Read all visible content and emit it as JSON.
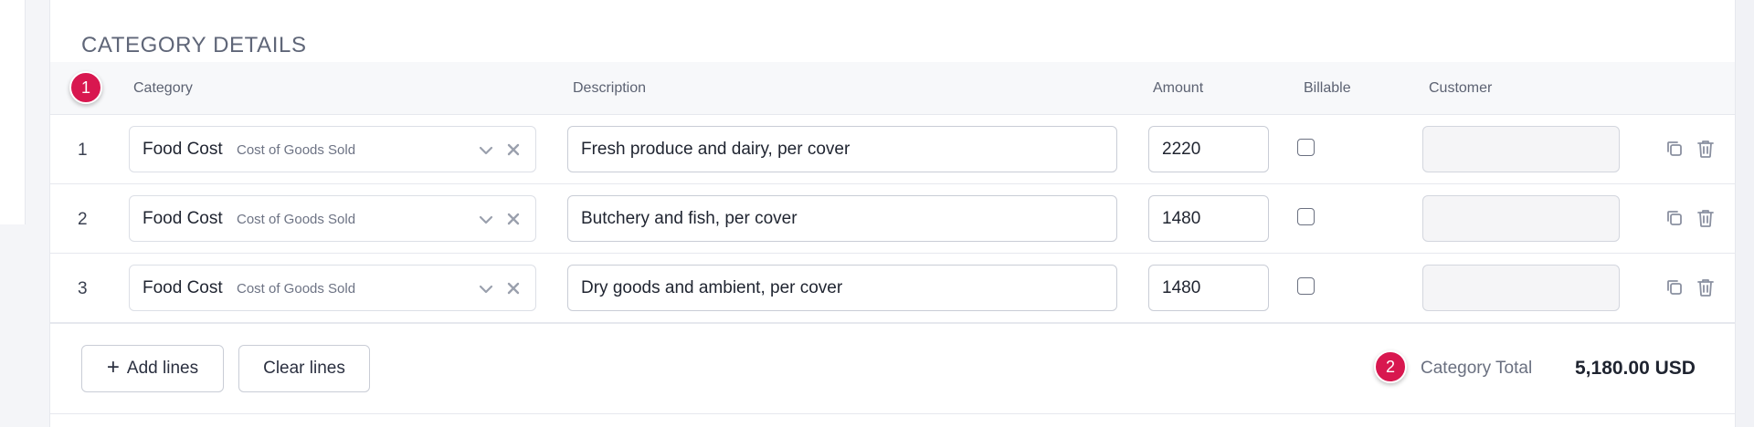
{
  "section": {
    "title": "CATEGORY DETAILS"
  },
  "table": {
    "headers": {
      "category": "Category",
      "description": "Description",
      "amount": "Amount",
      "billable": "Billable",
      "customer": "Customer"
    },
    "rows": [
      {
        "num": "1",
        "category": "Food Cost",
        "category_type": "Cost of Goods Sold",
        "description": "Fresh produce and dairy, per cover",
        "amount": "2220",
        "billable": false,
        "customer": ""
      },
      {
        "num": "2",
        "category": "Food Cost",
        "category_type": "Cost of Goods Sold",
        "description": "Butchery and fish, per cover",
        "amount": "1480",
        "billable": false,
        "customer": ""
      },
      {
        "num": "3",
        "category": "Food Cost",
        "category_type": "Cost of Goods Sold",
        "description": "Dry goods and ambient, per cover",
        "amount": "1480",
        "billable": false,
        "customer": ""
      }
    ]
  },
  "footer": {
    "add_lines_label": "Add lines",
    "clear_lines_label": "Clear lines",
    "total_label": "Category Total",
    "total_value": "5,180.00 USD"
  },
  "markers": {
    "first": "1",
    "second": "2"
  },
  "icons": {
    "dropdown": "chevron-down-icon",
    "clear": "close-icon",
    "copy": "copy-icon",
    "delete": "trash-icon",
    "add": "plus-icon"
  },
  "colors": {
    "marker": "#d8174f",
    "text": "#1f2430",
    "muted": "#6a7080"
  }
}
